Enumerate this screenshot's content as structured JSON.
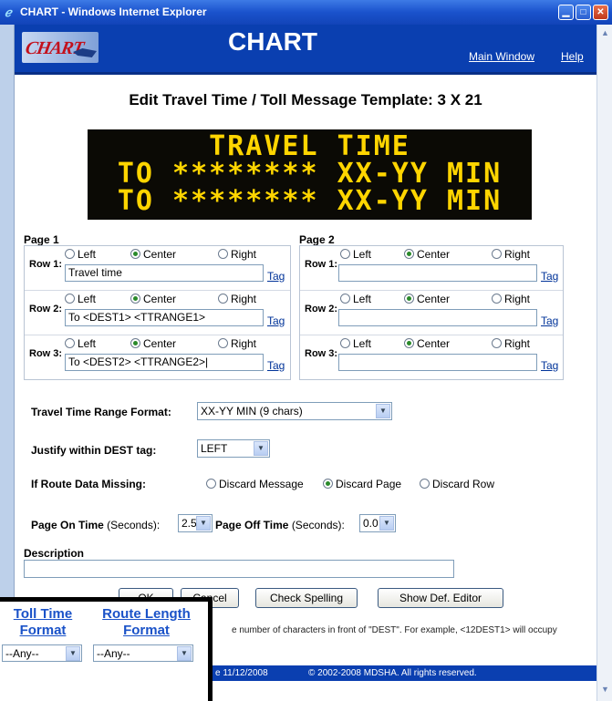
{
  "window": {
    "title": "CHART - Windows Internet Explorer"
  },
  "header": {
    "title": "CHART",
    "logo_text": "CHART",
    "links": {
      "main_window": "Main Window",
      "help": "Help"
    }
  },
  "page": {
    "heading": "Edit Travel Time / Toll Message Template: 3 X 21"
  },
  "sign": {
    "lines": [
      "TRAVEL TIME",
      "TO ******** XX-YY MIN",
      "TO ******** XX-YY MIN"
    ],
    "color": "#ffd500",
    "background": "#0b0a05"
  },
  "pages": [
    {
      "label": "Page 1",
      "rows": [
        {
          "label": "Row 1:",
          "align": "Center",
          "text": "Travel time"
        },
        {
          "label": "Row 2:",
          "align": "Center",
          "text": "To <DEST1> <TTRANGE1>"
        },
        {
          "label": "Row 3:",
          "align": "Center",
          "text": "To <DEST2> <TTRANGE2>|"
        }
      ]
    },
    {
      "label": "Page 2",
      "rows": [
        {
          "label": "Row 1:",
          "align": "Center",
          "text": ""
        },
        {
          "label": "Row 2:",
          "align": "Center",
          "text": ""
        },
        {
          "label": "Row 3:",
          "align": "Center",
          "text": ""
        }
      ]
    }
  ],
  "align_options": [
    "Left",
    "Center",
    "Right"
  ],
  "tag_link": "Tag",
  "form": {
    "tt_range": {
      "label": "Travel Time Range Format:",
      "value": "XX-YY MIN (9 chars)"
    },
    "justify": {
      "label": "Justify within DEST tag:",
      "value": "LEFT"
    },
    "route_missing": {
      "label": "If Route Data Missing:",
      "options": [
        "Discard Message",
        "Discard Page",
        "Discard Row"
      ],
      "selected": "Discard Page"
    },
    "page_on": {
      "label": "Page On Time",
      "unit": "(Seconds):",
      "value": "2.5"
    },
    "page_off": {
      "label": "Page Off Time",
      "unit": "(Seconds):",
      "value": "0.0"
    },
    "description": {
      "label": "Description",
      "value": ""
    }
  },
  "buttons": {
    "ok": "OK",
    "cancel": "Cancel",
    "check_spelling": "Check Spelling",
    "show_def_editor": "Show Def. Editor"
  },
  "note": "e number of characters in front of \"DEST\". For example, <12DEST1> will occupy",
  "footer": {
    "date": "e 11/12/2008",
    "copyright": "© 2002-2008 MDSHA. All rights reserved."
  },
  "inset": {
    "toll_time_header": [
      "Toll Time",
      "Format"
    ],
    "route_length_header": [
      "Route Length",
      "Format"
    ],
    "toll_time_value": "--Any--",
    "route_length_value": "--Any--"
  }
}
